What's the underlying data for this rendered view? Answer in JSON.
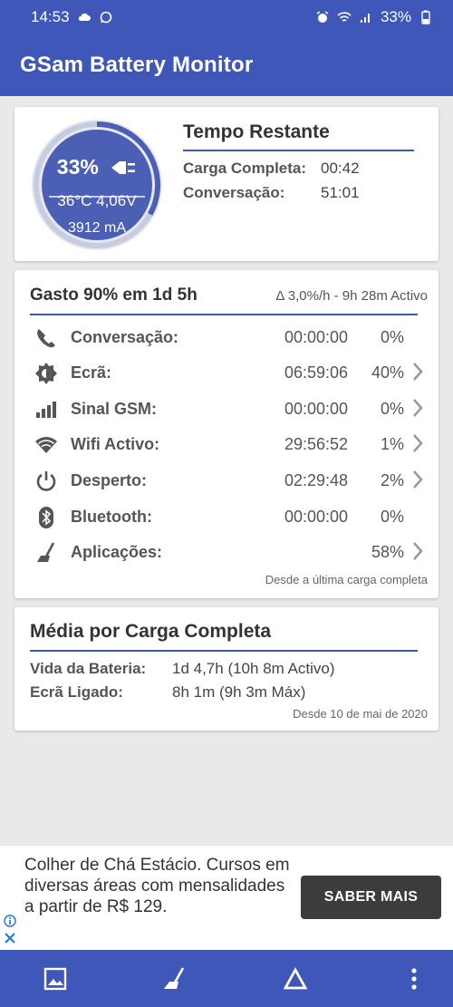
{
  "status_bar": {
    "time": "14:53",
    "battery_text": "33%"
  },
  "app": {
    "title": "GSam Battery Monitor"
  },
  "summary": {
    "percent": "33%",
    "percent_value": 33,
    "temp_voltage": "36°C  4,06V",
    "current": "3912 mA",
    "title": "Tempo Restante",
    "rows": [
      {
        "label": "Carga Completa:",
        "value": "00:42"
      },
      {
        "label": "Conversação:",
        "value": "51:01"
      }
    ]
  },
  "usage": {
    "title": "Gasto 90% em 1d 5h",
    "rate": "Δ 3,0%/h - 9h 28m Activo",
    "rows": [
      {
        "icon": "phone-icon",
        "label": "Conversação:",
        "time": "00:00:00",
        "percent": "0%",
        "chevron": false
      },
      {
        "icon": "screen-brightness-icon",
        "label": "Ecrã:",
        "time": "06:59:06",
        "percent": "40%",
        "chevron": true
      },
      {
        "icon": "signal-bars-icon",
        "label": "Sinal GSM:",
        "time": "00:00:00",
        "percent": "0%",
        "chevron": true
      },
      {
        "icon": "wifi-icon",
        "label": "Wifi Activo:",
        "time": "29:56:52",
        "percent": "1%",
        "chevron": true
      },
      {
        "icon": "power-icon",
        "label": "Desperto:",
        "time": "02:29:48",
        "percent": "2%",
        "chevron": true
      },
      {
        "icon": "bluetooth-icon",
        "label": "Bluetooth:",
        "time": "00:00:00",
        "percent": "0%",
        "chevron": false
      },
      {
        "icon": "broom-icon",
        "label": "Aplicações:",
        "time": "",
        "percent": "58%",
        "chevron": true
      }
    ],
    "footer": "Desde a última carga completa"
  },
  "average": {
    "title": "Média por Carga Completa",
    "rows": [
      {
        "label": "Vida da Bateria:",
        "value": "1d 4,7h (10h 8m Activo)"
      },
      {
        "label": "Ecrã Ligado:",
        "value": "8h 1m (9h 3m Máx)"
      }
    ],
    "footer": "Desde 10 de mai de 2020"
  },
  "ad": {
    "text": "Colher de Chá Estácio. Cursos em diversas áreas com mensalidades a partir de R$ 129.",
    "button": "SABER MAIS"
  },
  "bottom_nav": [
    {
      "icon": "image-icon"
    },
    {
      "icon": "broom-icon"
    },
    {
      "icon": "delta-icon"
    },
    {
      "icon": "more-vertical-icon"
    }
  ],
  "colors": {
    "primary": "#3f57b9",
    "gauge_fill": "#4b5fb5",
    "background": "#e9e9e9"
  }
}
